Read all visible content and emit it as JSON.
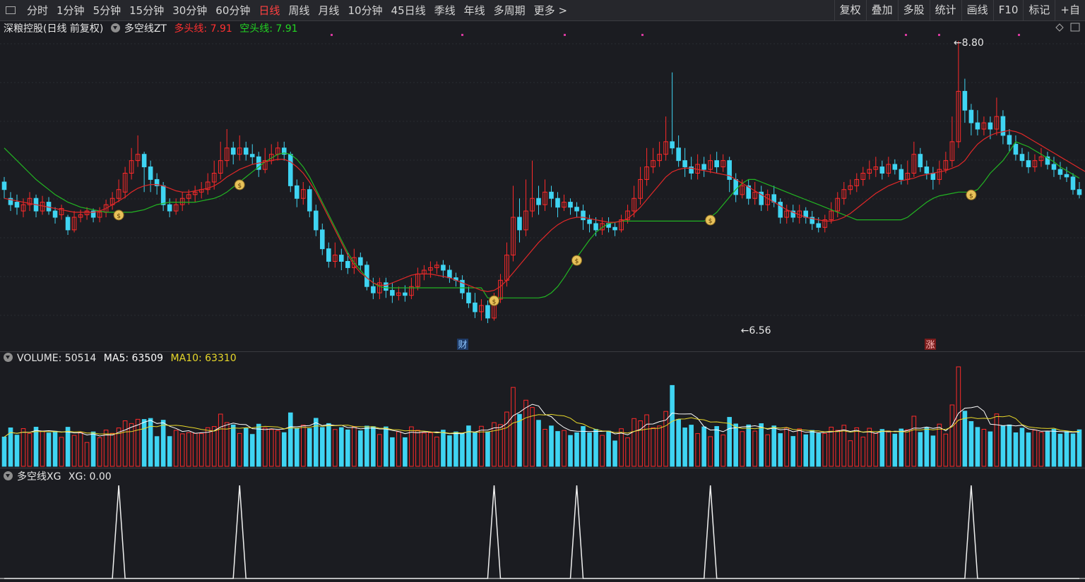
{
  "toolbar": {
    "left_items": [
      "分时",
      "1分钟",
      "5分钟",
      "15分钟",
      "30分钟",
      "60分钟",
      "日线",
      "周线",
      "月线",
      "10分钟",
      "45日线",
      "季线",
      "年线",
      "多周期",
      "更多 >"
    ],
    "active": "日线",
    "right_items": [
      "复权",
      "叠加",
      "多股",
      "统计",
      "画线",
      "F10",
      "标记",
      "+自"
    ]
  },
  "main_panel": {
    "stock_title": "深粮控股(日线 前复权)",
    "indicator_name": "多空线ZT",
    "bull_label": "多头线: 7.91",
    "bear_label": "空头线: 7.91",
    "high_label": "8.80",
    "low_label": "6.56",
    "event_label_cai": "财",
    "event_label_zhang": "涨"
  },
  "volume_panel": {
    "label": "VOLUME: 50514",
    "ma5_label": "MA5: 63509",
    "ma10_label": "MA10: 63310"
  },
  "xg_panel": {
    "label": "多空线XG",
    "value_label": "XG: 0.00"
  },
  "colors": {
    "up": "#ff2a2a",
    "down": "#3fd4f2",
    "flat": "#c8c8c8",
    "bull_line": "#e02828",
    "bear_line": "#22b422",
    "ma5": "#ffffff",
    "ma10": "#e8d82a",
    "marker": "#d6399e",
    "coin": "#e8c25a"
  },
  "chart_data": {
    "type": "candlestick",
    "price_scale": {
      "max": 8.8,
      "min": 6.56
    },
    "candles": [
      [
        7.68,
        7.62,
        7.72,
        7.55
      ],
      [
        7.55,
        7.5,
        7.6,
        7.45
      ],
      [
        7.52,
        7.48,
        7.58,
        7.42
      ],
      [
        7.45,
        7.5,
        7.55,
        7.4
      ],
      [
        7.5,
        7.55,
        7.6,
        7.45
      ],
      [
        7.55,
        7.45,
        7.58,
        7.4
      ],
      [
        7.45,
        7.52,
        7.57,
        7.42
      ],
      [
        7.52,
        7.45,
        7.56,
        7.42
      ],
      [
        7.45,
        7.4,
        7.48,
        7.35
      ],
      [
        7.42,
        7.47,
        7.5,
        7.38
      ],
      [
        7.4,
        7.3,
        7.42,
        7.26
      ],
      [
        7.3,
        7.4,
        7.45,
        7.28
      ],
      [
        7.4,
        7.42,
        7.46,
        7.36
      ],
      [
        7.42,
        7.45,
        7.48,
        7.38
      ],
      [
        7.45,
        7.4,
        7.47,
        7.36
      ],
      [
        7.4,
        7.44,
        7.48,
        7.36
      ],
      [
        7.44,
        7.5,
        7.54,
        7.4
      ],
      [
        7.5,
        7.55,
        7.6,
        7.46
      ],
      [
        7.55,
        7.62,
        7.7,
        7.52
      ],
      [
        7.6,
        7.75,
        7.8,
        7.55
      ],
      [
        7.75,
        7.85,
        7.95,
        7.7
      ],
      [
        7.85,
        7.9,
        8.05,
        7.8
      ],
      [
        7.9,
        7.8,
        7.92,
        7.6
      ],
      [
        7.8,
        7.7,
        7.85,
        7.6
      ],
      [
        7.7,
        7.65,
        7.75,
        7.58
      ],
      [
        7.65,
        7.5,
        7.68,
        7.45
      ],
      [
        7.5,
        7.45,
        7.55,
        7.4
      ],
      [
        7.45,
        7.5,
        7.55,
        7.42
      ],
      [
        7.5,
        7.55,
        7.6,
        7.45
      ],
      [
        7.55,
        7.58,
        7.62,
        7.5
      ],
      [
        7.58,
        7.6,
        7.65,
        7.52
      ],
      [
        7.6,
        7.62,
        7.68,
        7.55
      ],
      [
        7.62,
        7.68,
        7.75,
        7.58
      ],
      [
        7.68,
        7.75,
        7.85,
        7.62
      ],
      [
        7.75,
        7.85,
        8.0,
        7.7
      ],
      [
        7.85,
        7.95,
        8.1,
        7.8
      ],
      [
        7.95,
        7.9,
        8.0,
        7.82
      ],
      [
        7.9,
        7.95,
        8.05,
        7.85
      ],
      [
        7.95,
        7.9,
        8.0,
        7.85
      ],
      [
        7.9,
        7.88,
        7.98,
        7.82
      ],
      [
        7.88,
        7.78,
        7.92,
        7.72
      ],
      [
        7.78,
        7.85,
        7.95,
        7.75
      ],
      [
        7.85,
        7.9,
        7.98,
        7.82
      ],
      [
        7.9,
        7.95,
        8.0,
        7.85
      ],
      [
        7.95,
        7.9,
        8.0,
        7.85
      ],
      [
        7.9,
        7.65,
        7.92,
        7.6
      ],
      [
        7.65,
        7.55,
        7.7,
        7.48
      ],
      [
        7.55,
        7.62,
        7.68,
        7.5
      ],
      [
        7.62,
        7.45,
        7.65,
        7.4
      ],
      [
        7.45,
        7.3,
        7.5,
        7.25
      ],
      [
        7.3,
        7.15,
        7.35,
        7.1
      ],
      [
        7.15,
        7.05,
        7.2,
        7.0
      ],
      [
        7.05,
        7.1,
        7.2,
        7.0
      ],
      [
        7.1,
        7.05,
        7.15,
        6.98
      ],
      [
        7.05,
        7.0,
        7.12,
        6.95
      ],
      [
        7.0,
        7.08,
        7.15,
        6.95
      ],
      [
        7.08,
        7.02,
        7.12,
        6.98
      ],
      [
        7.02,
        6.85,
        7.05,
        6.82
      ],
      [
        6.85,
        6.8,
        6.92,
        6.75
      ],
      [
        6.8,
        6.88,
        6.92,
        6.75
      ],
      [
        6.88,
        6.82,
        6.92,
        6.76
      ],
      [
        6.82,
        6.78,
        6.88,
        6.72
      ],
      [
        6.78,
        6.8,
        6.85,
        6.74
      ],
      [
        6.8,
        6.78,
        6.86,
        6.73
      ],
      [
        6.78,
        6.85,
        6.92,
        6.75
      ],
      [
        6.85,
        6.95,
        7.0,
        6.82
      ],
      [
        6.95,
        6.98,
        7.02,
        6.9
      ],
      [
        6.98,
        7.0,
        7.05,
        6.92
      ],
      [
        7.0,
        7.02,
        7.05,
        6.95
      ],
      [
        7.02,
        6.98,
        7.06,
        6.92
      ],
      [
        6.98,
        6.92,
        7.02,
        6.88
      ],
      [
        6.92,
        6.9,
        6.96,
        6.85
      ],
      [
        6.9,
        6.8,
        6.94,
        6.75
      ],
      [
        6.8,
        6.72,
        6.85,
        6.68
      ],
      [
        6.72,
        6.65,
        6.8,
        6.6
      ],
      [
        6.65,
        6.7,
        6.75,
        6.58
      ],
      [
        6.7,
        6.6,
        6.74,
        6.56
      ],
      [
        6.6,
        6.75,
        6.8,
        6.58
      ],
      [
        6.75,
        6.9,
        6.95,
        6.72
      ],
      [
        6.9,
        7.1,
        7.2,
        6.85
      ],
      [
        7.1,
        7.4,
        7.65,
        7.05
      ],
      [
        7.4,
        7.3,
        7.55,
        7.2
      ],
      [
        7.3,
        7.45,
        7.7,
        7.25
      ],
      [
        7.45,
        7.55,
        7.85,
        7.4
      ],
      [
        7.55,
        7.5,
        7.65,
        7.42
      ],
      [
        7.5,
        7.6,
        7.7,
        7.45
      ],
      [
        7.6,
        7.55,
        7.65,
        7.48
      ],
      [
        7.55,
        7.48,
        7.6,
        7.4
      ],
      [
        7.48,
        7.52,
        7.58,
        7.45
      ],
      [
        7.52,
        7.48,
        7.55,
        7.42
      ],
      [
        7.48,
        7.45,
        7.52,
        7.4
      ],
      [
        7.45,
        7.38,
        7.5,
        7.3
      ],
      [
        7.38,
        7.35,
        7.42,
        7.28
      ],
      [
        7.35,
        7.3,
        7.4,
        7.25
      ],
      [
        7.3,
        7.35,
        7.4,
        7.26
      ],
      [
        7.35,
        7.32,
        7.4,
        7.28
      ],
      [
        7.32,
        7.3,
        7.36,
        7.25
      ],
      [
        7.3,
        7.38,
        7.42,
        7.28
      ],
      [
        7.38,
        7.45,
        7.5,
        7.35
      ],
      [
        7.45,
        7.55,
        7.65,
        7.4
      ],
      [
        7.55,
        7.7,
        7.8,
        7.5
      ],
      [
        7.7,
        7.8,
        7.95,
        7.65
      ],
      [
        7.8,
        7.85,
        7.95,
        7.75
      ],
      [
        7.85,
        7.9,
        8.0,
        7.8
      ],
      [
        7.9,
        8.0,
        8.2,
        7.85
      ],
      [
        8.0,
        7.95,
        8.55,
        7.9
      ],
      [
        7.95,
        7.85,
        8.05,
        7.8
      ],
      [
        7.85,
        7.8,
        7.95,
        7.72
      ],
      [
        7.8,
        7.75,
        7.88,
        7.7
      ],
      [
        7.75,
        7.82,
        7.9,
        7.7
      ],
      [
        7.82,
        7.78,
        7.88,
        7.72
      ],
      [
        7.78,
        7.85,
        7.9,
        7.75
      ],
      [
        7.85,
        7.8,
        7.92,
        7.75
      ],
      [
        7.8,
        7.85,
        7.9,
        7.76
      ],
      [
        7.85,
        7.7,
        7.88,
        7.6
      ],
      [
        7.7,
        7.58,
        7.75,
        7.52
      ],
      [
        7.58,
        7.65,
        7.7,
        7.55
      ],
      [
        7.65,
        7.55,
        7.7,
        7.5
      ],
      [
        7.55,
        7.6,
        7.68,
        7.5
      ],
      [
        7.6,
        7.5,
        7.65,
        7.45
      ],
      [
        7.5,
        7.58,
        7.62,
        7.45
      ],
      [
        7.58,
        7.52,
        7.65,
        7.48
      ],
      [
        7.52,
        7.4,
        7.55,
        7.35
      ],
      [
        7.4,
        7.45,
        7.5,
        7.35
      ],
      [
        7.45,
        7.4,
        7.5,
        7.36
      ],
      [
        7.4,
        7.45,
        7.5,
        7.35
      ],
      [
        7.45,
        7.4,
        7.48,
        7.35
      ],
      [
        7.4,
        7.35,
        7.45,
        7.3
      ],
      [
        7.35,
        7.32,
        7.4,
        7.28
      ],
      [
        7.32,
        7.38,
        7.42,
        7.28
      ],
      [
        7.38,
        7.45,
        7.52,
        7.35
      ],
      [
        7.45,
        7.55,
        7.6,
        7.4
      ],
      [
        7.55,
        7.62,
        7.68,
        7.5
      ],
      [
        7.62,
        7.65,
        7.7,
        7.58
      ],
      [
        7.65,
        7.7,
        7.75,
        7.6
      ],
      [
        7.7,
        7.75,
        7.8,
        7.65
      ],
      [
        7.75,
        7.78,
        7.85,
        7.7
      ],
      [
        7.78,
        7.8,
        7.88,
        7.72
      ],
      [
        7.8,
        7.75,
        7.85,
        7.7
      ],
      [
        7.75,
        7.82,
        7.88,
        7.72
      ],
      [
        7.82,
        7.78,
        7.86,
        7.74
      ],
      [
        7.78,
        7.7,
        7.82,
        7.66
      ],
      [
        7.7,
        7.75,
        7.85,
        7.66
      ],
      [
        7.75,
        7.9,
        8.0,
        7.72
      ],
      [
        7.9,
        7.8,
        7.95,
        7.76
      ],
      [
        7.8,
        7.75,
        7.85,
        7.7
      ],
      [
        7.75,
        7.7,
        7.8,
        7.62
      ],
      [
        7.7,
        7.78,
        7.85,
        7.66
      ],
      [
        7.78,
        7.85,
        7.92,
        7.75
      ],
      [
        7.85,
        8.0,
        8.2,
        7.8
      ],
      [
        8.0,
        8.4,
        8.8,
        7.95
      ],
      [
        8.4,
        8.25,
        8.5,
        8.15
      ],
      [
        8.25,
        8.15,
        8.3,
        8.05
      ],
      [
        8.15,
        8.1,
        8.25,
        8.05
      ],
      [
        8.1,
        8.15,
        8.2,
        8.05
      ],
      [
        8.15,
        8.1,
        8.2,
        8.02
      ],
      [
        8.1,
        8.2,
        8.35,
        8.05
      ],
      [
        8.2,
        8.05,
        8.25,
        7.98
      ],
      [
        8.05,
        7.98,
        8.1,
        7.92
      ],
      [
        7.98,
        7.9,
        8.05,
        7.85
      ],
      [
        7.9,
        7.85,
        7.95,
        7.8
      ],
      [
        7.85,
        7.8,
        7.92,
        7.75
      ],
      [
        7.8,
        7.85,
        7.9,
        7.76
      ],
      [
        7.85,
        7.88,
        7.95,
        7.8
      ],
      [
        7.88,
        7.82,
        7.92,
        7.78
      ],
      [
        7.82,
        7.78,
        7.88,
        7.72
      ],
      [
        7.78,
        7.74,
        7.84,
        7.7
      ],
      [
        7.74,
        7.72,
        7.8,
        7.68
      ],
      [
        7.72,
        7.62,
        7.75,
        7.58
      ],
      [
        7.62,
        7.58,
        7.68,
        7.55
      ]
    ],
    "bull_line": [
      7.55,
      7.54,
      7.53,
      7.52,
      7.51,
      7.5,
      7.49,
      7.48,
      7.47,
      7.46,
      7.45,
      7.44,
      7.44,
      7.44,
      7.44,
      7.45,
      7.47,
      7.5,
      7.53,
      7.56,
      7.6,
      7.63,
      7.65,
      7.66,
      7.66,
      7.65,
      7.63,
      7.61,
      7.6,
      7.6,
      7.61,
      7.62,
      7.63,
      7.65,
      7.68,
      7.72,
      7.75,
      7.78,
      7.8,
      7.82,
      7.83,
      7.84,
      7.85,
      7.86,
      7.86,
      7.84,
      7.8,
      7.75,
      7.68,
      7.6,
      7.5,
      7.4,
      7.3,
      7.2,
      7.1,
      7.02,
      6.96,
      6.92,
      6.88,
      6.86,
      6.86,
      6.88,
      6.9,
      6.92,
      6.94,
      6.95,
      6.95,
      6.95,
      6.94,
      6.93,
      6.92,
      6.9,
      6.88,
      6.86,
      6.84,
      6.82,
      6.81,
      6.82,
      6.85,
      6.9,
      6.96,
      7.02,
      7.08,
      7.14,
      7.2,
      7.25,
      7.3,
      7.34,
      7.37,
      7.39,
      7.4,
      7.4,
      7.39,
      7.38,
      7.37,
      7.36,
      7.36,
      7.37,
      7.39,
      7.43,
      7.48,
      7.54,
      7.6,
      7.66,
      7.72,
      7.76,
      7.78,
      7.79,
      7.79,
      7.78,
      7.77,
      7.76,
      7.75,
      7.74,
      7.73,
      7.7,
      7.67,
      7.64,
      7.61,
      7.58,
      7.55,
      7.52,
      7.49,
      7.46,
      7.44,
      7.42,
      7.4,
      7.39,
      7.38,
      7.37,
      7.37,
      7.38,
      7.4,
      7.43,
      7.47,
      7.51,
      7.55,
      7.59,
      7.62,
      7.65,
      7.67,
      7.69,
      7.7,
      7.71,
      7.73,
      7.74,
      7.75,
      7.76,
      7.77,
      7.79,
      7.81,
      7.85,
      7.92,
      7.98,
      8.02,
      8.05,
      8.07,
      8.08,
      8.09,
      8.08,
      8.06,
      8.03,
      8.0,
      7.97,
      7.94,
      7.91,
      7.88,
      7.85,
      7.82,
      7.79,
      7.76,
      7.73
    ],
    "bear_line": [
      7.95,
      7.9,
      7.85,
      7.8,
      7.75,
      7.7,
      7.66,
      7.62,
      7.58,
      7.55,
      7.52,
      7.5,
      7.48,
      7.47,
      7.46,
      7.45,
      7.44,
      7.44,
      7.44,
      7.44,
      7.44,
      7.45,
      7.46,
      7.48,
      7.5,
      7.51,
      7.52,
      7.52,
      7.52,
      7.52,
      7.52,
      7.53,
      7.54,
      7.55,
      7.57,
      7.6,
      7.64,
      7.68,
      7.72,
      7.76,
      7.8,
      7.84,
      7.87,
      7.9,
      7.91,
      7.9,
      7.86,
      7.8,
      7.72,
      7.62,
      7.52,
      7.42,
      7.32,
      7.22,
      7.12,
      7.04,
      6.98,
      6.92,
      6.88,
      6.85,
      6.84,
      6.84,
      6.84,
      6.84,
      6.84,
      6.84,
      6.84,
      6.84,
      6.84,
      6.84,
      6.84,
      6.84,
      6.84,
      6.84,
      6.84,
      6.84,
      6.76,
      6.76,
      6.76,
      6.76,
      6.76,
      6.76,
      6.76,
      6.76,
      6.76,
      6.77,
      6.8,
      6.85,
      6.92,
      7.0,
      7.08,
      7.15,
      7.22,
      7.28,
      7.32,
      7.35,
      7.36,
      7.37,
      7.37,
      7.37,
      7.37,
      7.37,
      7.37,
      7.37,
      7.37,
      7.37,
      7.37,
      7.37,
      7.37,
      7.37,
      7.37,
      7.4,
      7.44,
      7.5,
      7.56,
      7.62,
      7.67,
      7.7,
      7.7,
      7.68,
      7.66,
      7.64,
      7.62,
      7.6,
      7.58,
      7.56,
      7.54,
      7.52,
      7.5,
      7.48,
      7.46,
      7.44,
      7.42,
      7.4,
      7.38,
      7.38,
      7.38,
      7.38,
      7.38,
      7.38,
      7.38,
      7.38,
      7.4,
      7.44,
      7.48,
      7.52,
      7.55,
      7.57,
      7.58,
      7.59,
      7.6,
      7.6,
      7.6,
      7.62,
      7.68,
      7.75,
      7.8,
      7.85,
      7.92,
      8.0,
      7.98,
      7.96,
      7.93,
      7.9,
      7.87,
      7.84,
      7.8,
      7.77,
      7.74,
      7.71
    ]
  }
}
